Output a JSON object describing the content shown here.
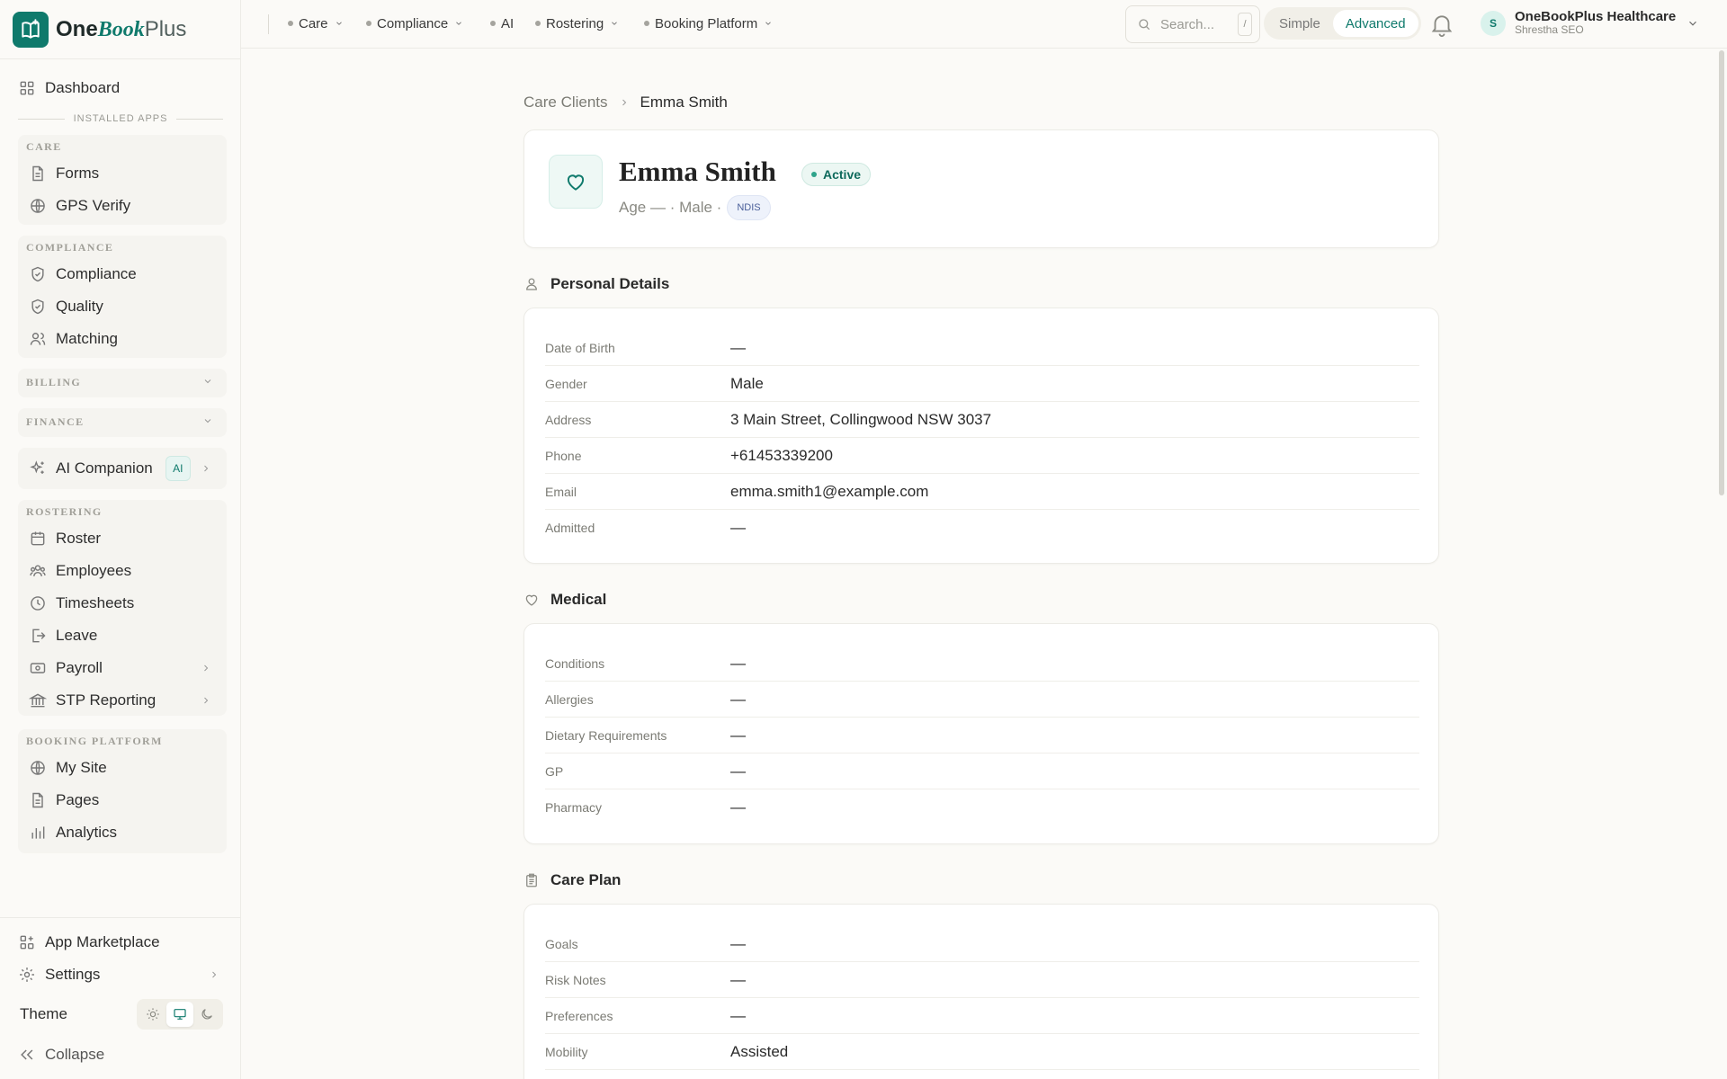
{
  "brand": {
    "name_bold": "One",
    "name_accent": "Book",
    "name_rest": "Plus"
  },
  "sidebar": {
    "dashboard": "Dashboard",
    "installed_apps": "INSTALLED APPS",
    "care": {
      "title": "CARE",
      "items": [
        "Forms",
        "GPS Verify"
      ]
    },
    "compliance": {
      "title": "COMPLIANCE",
      "items": [
        "Compliance",
        "Quality",
        "Matching"
      ]
    },
    "billing": "BILLING",
    "finance": "FINANCE",
    "ai_companion": "AI Companion",
    "ai_badge": "AI",
    "rostering": {
      "title": "ROSTERING",
      "items": [
        "Roster",
        "Employees",
        "Timesheets",
        "Leave",
        "Payroll",
        "STP Reporting"
      ]
    },
    "booking": {
      "title": "BOOKING PLATFORM",
      "items": [
        "My Site",
        "Pages",
        "Analytics"
      ]
    },
    "app_marketplace": "App Marketplace",
    "settings": "Settings",
    "theme": "Theme",
    "collapse": "Collapse"
  },
  "topbar": {
    "menus": [
      "Care",
      "Compliance",
      "AI",
      "Rostering",
      "Booking Platform"
    ],
    "search_placeholder": "Search...",
    "search_shortcut": "/",
    "mode_simple": "Simple",
    "mode_advanced": "Advanced",
    "org_name": "OneBookPlus Healthcare",
    "org_user": "Shrestha SEO",
    "avatar_initial": "S"
  },
  "breadcrumb": {
    "parent": "Care Clients",
    "current": "Emma Smith"
  },
  "client": {
    "name": "Emma Smith",
    "status": "Active",
    "meta": "Age — · Male ·",
    "funding": "NDIS"
  },
  "personal": {
    "title": "Personal Details",
    "rows": [
      {
        "label": "Date of Birth",
        "value": "—"
      },
      {
        "label": "Gender",
        "value": "Male"
      },
      {
        "label": "Address",
        "value": "3 Main Street, Collingwood NSW 3037"
      },
      {
        "label": "Phone",
        "value": "+61453339200"
      },
      {
        "label": "Email",
        "value": "emma.smith1@example.com"
      },
      {
        "label": "Admitted",
        "value": "—"
      }
    ]
  },
  "medical": {
    "title": "Medical",
    "rows": [
      {
        "label": "Conditions",
        "value": "—"
      },
      {
        "label": "Allergies",
        "value": "—"
      },
      {
        "label": "Dietary Requirements",
        "value": "—"
      },
      {
        "label": "GP",
        "value": "—"
      },
      {
        "label": "Pharmacy",
        "value": "—"
      }
    ]
  },
  "care_plan": {
    "title": "Care Plan",
    "rows": [
      {
        "label": "Goals",
        "value": "—"
      },
      {
        "label": "Risk Notes",
        "value": "—"
      },
      {
        "label": "Preferences",
        "value": "—"
      },
      {
        "label": "Mobility",
        "value": "Assisted"
      }
    ]
  },
  "colors": {
    "accent": "#0f7a6c",
    "background": "#fbfaf7"
  }
}
